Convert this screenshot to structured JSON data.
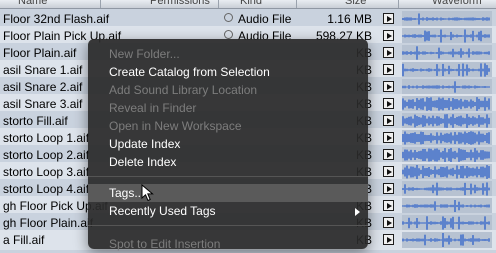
{
  "columns": {
    "name": "Name",
    "permissions": "Permissions",
    "kind": "Kind",
    "size": "Size",
    "waveform": "Waveform"
  },
  "rows": [
    {
      "name": "Floor 32nd Flash.aif",
      "kind": "Audio File",
      "size": "1.16 MB"
    },
    {
      "name": "Floor Plain Pick Up.aif",
      "kind": "Audio File",
      "size": "598.27 KB"
    },
    {
      "name": "Floor Plain.aif",
      "kind": "",
      "size": "KB"
    },
    {
      "name": "asil Snare 1.aif",
      "kind": "",
      "size": "KB"
    },
    {
      "name": "asil Snare 2.aif",
      "kind": "",
      "size": "KB"
    },
    {
      "name": "asil Snare 3.aif",
      "kind": "",
      "size": "KB"
    },
    {
      "name": "storto Fill.aif",
      "kind": "",
      "size": "KB"
    },
    {
      "name": "storto Loop 1.aif",
      "kind": "",
      "size": "KB"
    },
    {
      "name": "storto Loop 2.aif",
      "kind": "",
      "size": "KB"
    },
    {
      "name": "storto Loop 3.aif",
      "kind": "",
      "size": "KB"
    },
    {
      "name": "storto Loop 4.aif",
      "kind": "",
      "size": "KB"
    },
    {
      "name": "gh Floor Pick Up.aif",
      "kind": "",
      "size": "KB"
    },
    {
      "name": "gh Floor Plain.aif",
      "kind": "",
      "size": "KB"
    },
    {
      "name": "a Fill.aif",
      "kind": "",
      "size": "KB"
    }
  ],
  "context_menu": {
    "items": [
      {
        "label": "New Folder...",
        "enabled": false
      },
      {
        "label": "Create Catalog from Selection",
        "enabled": true
      },
      {
        "label": "Add Sound Library Location",
        "enabled": false
      },
      {
        "label": "Reveal in Finder",
        "enabled": false
      },
      {
        "label": "Open in New Workspace",
        "enabled": false
      },
      {
        "label": "Update Index",
        "enabled": true
      },
      {
        "label": "Delete Index",
        "enabled": true
      },
      {
        "label": "Tags...",
        "enabled": true,
        "highlighted": true
      },
      {
        "label": "Recently Used Tags",
        "enabled": true,
        "submenu": true
      },
      {
        "label": "Spot to Edit Insertion",
        "enabled": false
      }
    ]
  },
  "colors": {
    "row_odd": "#c9d2de",
    "row_even": "#dde3eb",
    "menu_bg": "#2a2a2a",
    "menu_highlight": "#5a5a5a",
    "waveform": "#1f56c9"
  },
  "icons": [
    "gear-icon",
    "play-icon",
    "waveform-icon",
    "submenu-arrow-icon",
    "mouse-cursor-icon"
  ]
}
